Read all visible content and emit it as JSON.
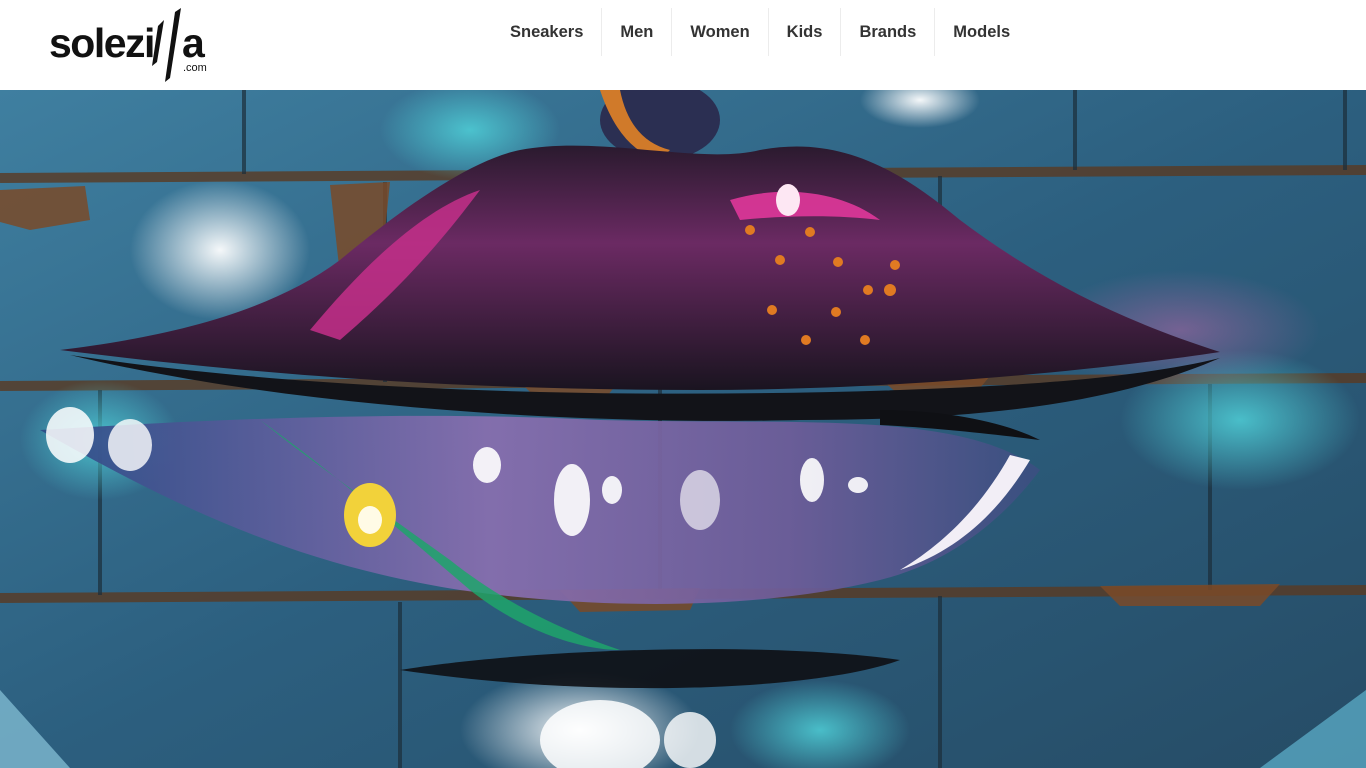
{
  "brand": {
    "name": "solezilla",
    "domain": ".com"
  },
  "nav": {
    "items": [
      {
        "label": "Sneakers"
      },
      {
        "label": "Men"
      },
      {
        "label": "Women"
      },
      {
        "label": "Kids"
      },
      {
        "label": "Brands"
      },
      {
        "label": "Models"
      }
    ]
  },
  "hero": {
    "image": "graffiti-lips-on-brick-wall"
  },
  "colors": {
    "header_bg": "#ffffff",
    "nav_text": "#333333",
    "logo": "#111111",
    "wall_teal": "#2f6f8c",
    "graffiti_magenta": "#c42f8a",
    "graffiti_black": "#111318"
  }
}
